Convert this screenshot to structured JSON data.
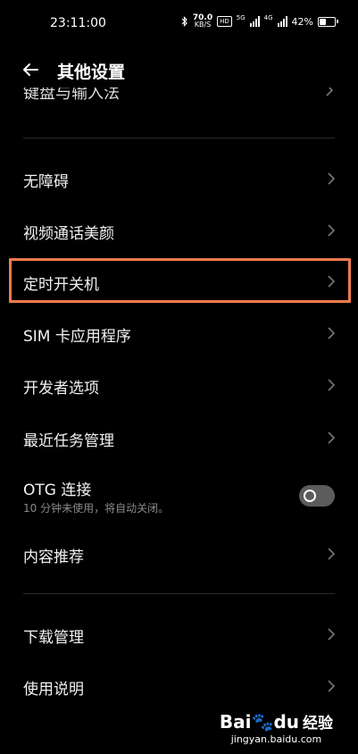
{
  "status": {
    "time": "23:11:00",
    "net_speed_value": "70.0",
    "net_speed_unit": "KB/S",
    "hd_label": "HD",
    "sim1_label": "5G",
    "sim2_label": "4G",
    "battery_percent": "42%",
    "battery_level": 0.42
  },
  "header": {
    "title": "其他设置"
  },
  "partial_item": {
    "label": "键盘与输入法"
  },
  "items": [
    {
      "label": "无障碍"
    },
    {
      "label": "视频通话美颜"
    },
    {
      "label": "定时开关机"
    },
    {
      "label": "SIM 卡应用程序"
    },
    {
      "label": "开发者选项"
    },
    {
      "label": "最近任务管理"
    },
    {
      "label": "OTG 连接",
      "subtitle": "10 分钟未使用，将自动关闭。",
      "toggle_on": false
    },
    {
      "label": "内容推荐"
    },
    {
      "label": "下载管理"
    },
    {
      "label": "使用说明"
    }
  ],
  "watermark": {
    "brand_latin": "Bai",
    "brand_du": "du",
    "brand_cn": "经验",
    "url": "jingyan.baidu.com"
  },
  "colors": {
    "background": "#000000",
    "highlight": "#ee7a4e",
    "toggle_off": "#5c5c5c"
  }
}
